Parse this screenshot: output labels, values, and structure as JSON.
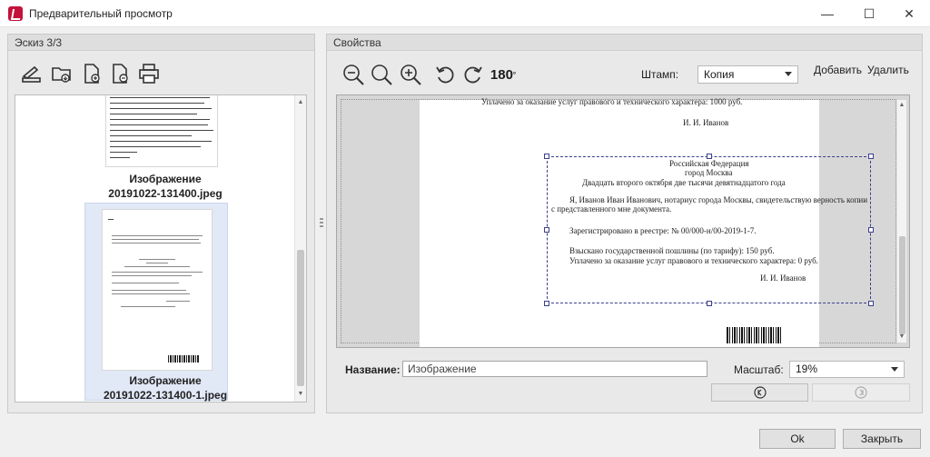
{
  "window": {
    "title": "Предварительный просмотр",
    "minimize": "—",
    "maximize": "☐",
    "close": "✕"
  },
  "left_panel": {
    "header": "Эскиз 3/3",
    "thumbnails": [
      {
        "caption_line1": "Изображение",
        "caption_line2": "20191022-131400.jpeg"
      },
      {
        "caption_line1": "Изображение",
        "caption_line2": "20191022-131400-1.jpeg"
      }
    ]
  },
  "right_panel": {
    "header": "Свойства",
    "rotate_label": "180",
    "stamp_label": "Штамп:",
    "stamp_value": "Копия",
    "add_label": "Добавить",
    "delete_label": "Удалить",
    "document": {
      "top_line": "Уплачено за оказание услуг правового и технического характера: 1000 руб.",
      "top_signature": "И. И. Иванов",
      "stamp_lines": [
        "Российская Федерация",
        "город Москва",
        "Двадцать второго октября две тысячи девятнадцатого года",
        "Я, Иванов Иван Иванович, нотариус города Москвы, свидетельствую верность копии",
        "с представленного мне документа.",
        "Зарегистрировано в реестре: № 00/000-н/00-2019-1-7.",
        "Взыскано государственной пошлины (по тарифу): 150 руб.",
        "Уплачено за оказание услуг правового и технического характера: 0 руб.",
        "И. И. Иванов"
      ]
    },
    "name_label": "Название:",
    "name_value": "Изображение",
    "scale_label": "Масштаб:",
    "scale_value": "19%"
  },
  "footer": {
    "ok_label": "Ok",
    "close_label": "Закрыть"
  }
}
